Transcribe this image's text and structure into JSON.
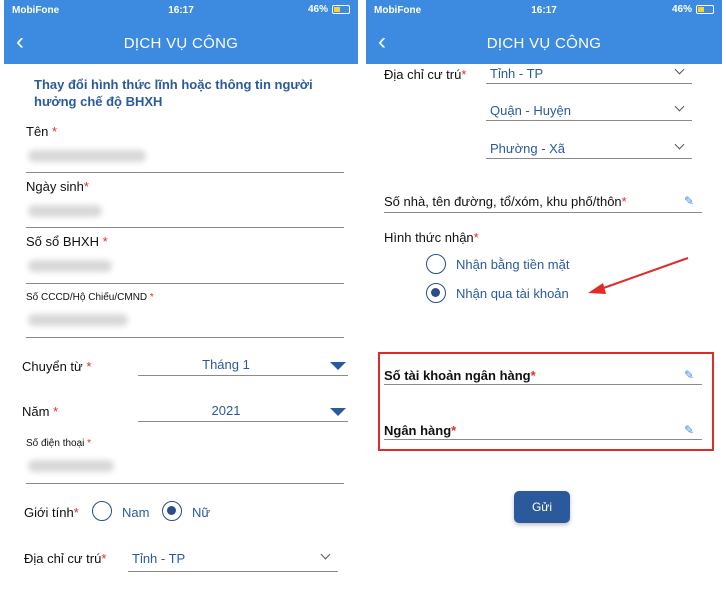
{
  "status_bar": {
    "carrier": "MobiFone",
    "time": "16:17",
    "battery": "46%",
    "battery_level": 0.46
  },
  "nav": {
    "title": "DỊCH VỤ CÔNG",
    "back_icon": "chevron-left-icon"
  },
  "left_screen": {
    "heading": "Thay đổi hình thức lĩnh hoặc thông tin người hưởng chế độ BHXH",
    "fields": {
      "name_label": "Tên",
      "dob_label": "Ngày sinh",
      "bhxh_label": "Số sổ BHXH",
      "id_label": "Số CCCD/Hộ Chiếu/CMND",
      "phone_label": "Số điện thoại"
    },
    "transfer_from": {
      "label": "Chuyển từ",
      "value": "Tháng 1"
    },
    "year": {
      "label": "Năm",
      "value": "2021"
    },
    "gender": {
      "label": "Giới tính",
      "options": [
        "Nam",
        "Nữ"
      ],
      "selected": "Nữ"
    },
    "address": {
      "label": "Địa chỉ cư trú",
      "province": "Tỉnh - TP"
    },
    "required_mark": "*"
  },
  "right_screen": {
    "address": {
      "label": "Địa chỉ cư trú",
      "province": "Tỉnh - TP",
      "district": "Quận - Huyện",
      "ward": "Phường - Xã"
    },
    "street_label": "Số nhà, tên đường, tổ/xóm, khu phố/thôn",
    "receive": {
      "label": "Hình thức nhận",
      "options": [
        "Nhận bằng tiền mặt",
        "Nhận qua tài khoản"
      ],
      "selected": "Nhận qua tài khoản"
    },
    "bank_account_label": "Số tài khoản ngân hàng",
    "bank_label": "Ngân hàng",
    "submit_label": "Gửi",
    "required_mark": "*"
  },
  "colors": {
    "accent": "#3c8be0",
    "label_blue": "#2b5a9c",
    "highlight": "#e02b2b",
    "radio": "#2b4e8a"
  }
}
